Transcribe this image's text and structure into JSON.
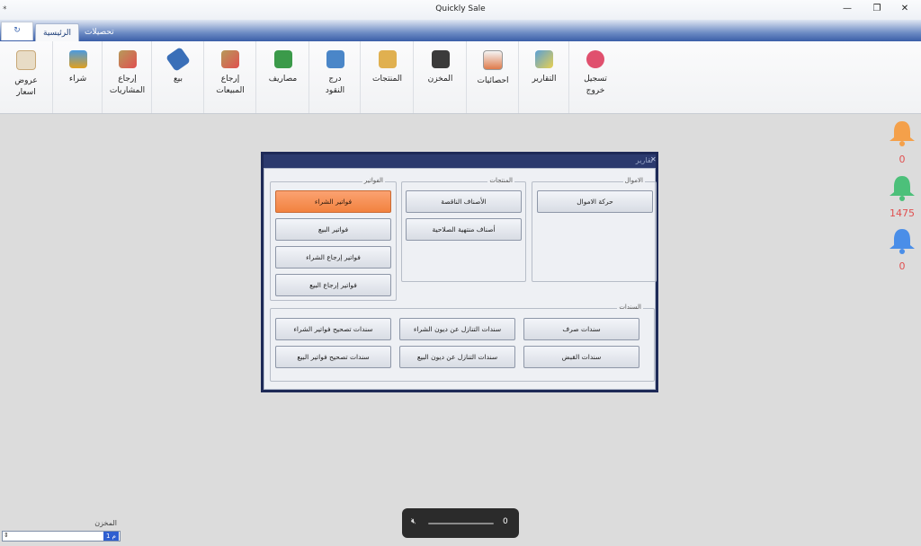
{
  "window": {
    "title": "Quickly Sale",
    "qat_icon": "pin-icon"
  },
  "tabs": [
    {
      "label": "الرئيسية",
      "active": true
    },
    {
      "label": "تحصيلات",
      "active": false
    }
  ],
  "ribbon": [
    {
      "label": "تسجيل\nخروج",
      "icon": "power-icon",
      "color": "#e0506e"
    },
    {
      "label": "التقارير",
      "icon": "report-pie-icon",
      "color": "#5aa0d6"
    },
    {
      "label": "احصائيات",
      "icon": "chart-icon",
      "color": "#e07a4a"
    },
    {
      "label": "المخزن",
      "icon": "warehouse-icon",
      "color": "#3b3b3b"
    },
    {
      "label": "المنتجات",
      "icon": "folders-icon",
      "color": "#e0b050"
    },
    {
      "label": "درج\nالنقود",
      "icon": "cash-drawer-icon",
      "color": "#4a86c8"
    },
    {
      "label": "مصاريف",
      "icon": "money-icon",
      "color": "#3b9a4a"
    },
    {
      "label": "إرجاع\nالمبيعات",
      "icon": "return-sales-icon",
      "color": "#b79a5a"
    },
    {
      "label": "بيع",
      "icon": "sale-tag-icon",
      "color": "#3a6fb8"
    },
    {
      "label": "إرجاع\nالمشتريات",
      "icon": "return-purchase-icon",
      "color": "#b79a5a"
    },
    {
      "label": "شراء",
      "icon": "cart-icon",
      "color": "#e0a020"
    },
    {
      "label": "عروض\nاسعار",
      "icon": "quote-icon",
      "color": "#c8a878"
    }
  ],
  "dialog": {
    "title": "تقارير",
    "groups": {
      "invoices": {
        "legend": "الفواتير",
        "buttons": [
          "فواتير الشراء",
          "فواتير البيع",
          "فواتير إرجاع الشراء",
          "فواتير إرجاع البيع"
        ]
      },
      "products": {
        "legend": "المنتجات",
        "buttons": [
          "الأصناف الناقصة",
          "أصناف منتهية الصلاحية"
        ]
      },
      "funds": {
        "legend": "الاموال",
        "buttons": [
          "حركة  الاموال"
        ]
      },
      "vouchers": {
        "legend": "السندات",
        "buttons": [
          "سندات تصحيح فواتير الشراء",
          "سندات التنازل عن ديون الشراء",
          "سندات صرف",
          "سندات تصحيح فواتير البيع",
          "سندات التنازل عن ديون البيع",
          "سندات القبض"
        ]
      }
    }
  },
  "notifications": [
    {
      "icon": "bell-orange-icon",
      "color": "#f4a04a",
      "count": "0"
    },
    {
      "icon": "bell-green-icon",
      "color": "#4cc07a",
      "count": "1475"
    },
    {
      "icon": "bell-blue-icon",
      "color": "#4a8ee8",
      "count": "0"
    }
  ],
  "store": {
    "label": "المخزن",
    "value": "م 1"
  },
  "volume": {
    "value": "0"
  }
}
